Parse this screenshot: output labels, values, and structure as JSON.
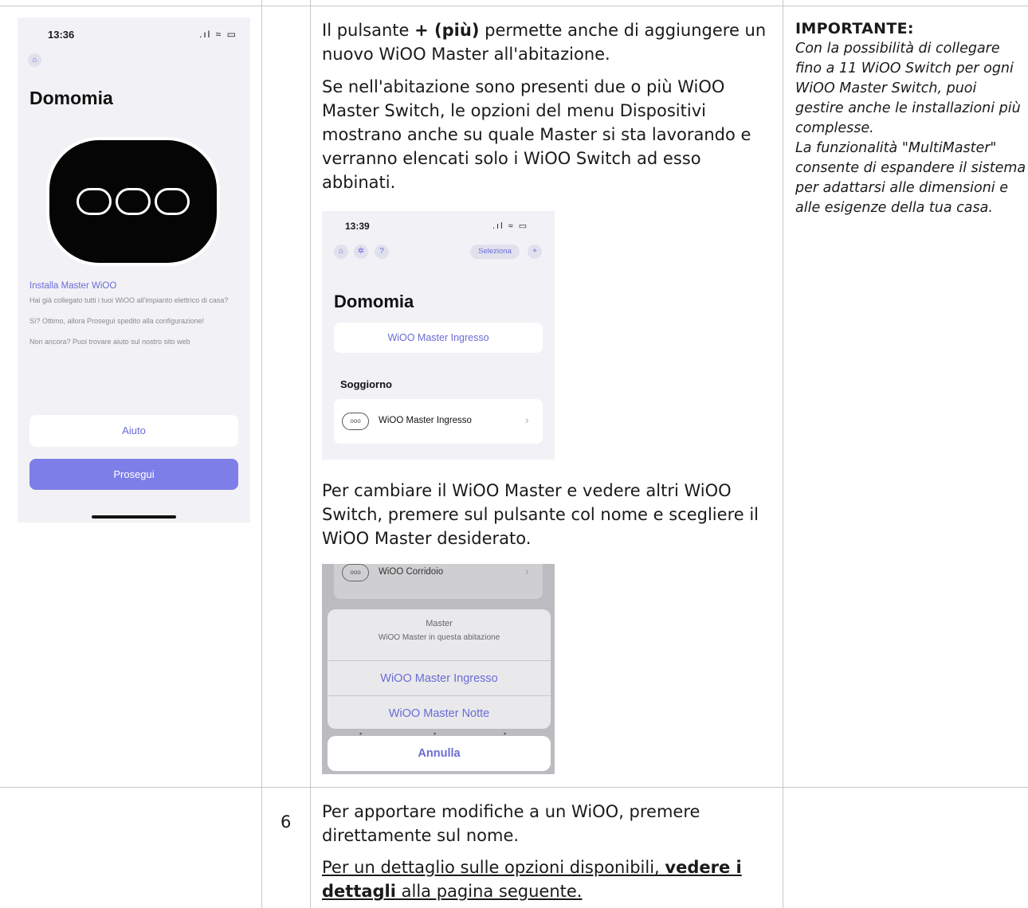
{
  "phone1": {
    "time": "13:36",
    "status": ".ıl ≈ ▭",
    "home_icon": "⌂",
    "title": "Domomia",
    "install_link": "Installa Master WiOO",
    "text1": "Hai già collegato tutti i tuoi WiOO all'impianto elettrico di casa?",
    "text2": "Sì? Ottimo, allora Prosegui spedito alla configurazione!",
    "text3": "Non ancora? Puoi trovare aiuto sul nostro sito web",
    "help_button": "Aiuto",
    "next_button": "Prosegui"
  },
  "phone2": {
    "time": "13:39",
    "status": ".ıl ≈ ▭",
    "home_icon": "⌂",
    "light_icon": "✲",
    "help_icon": "?",
    "select_button": "Seleziona",
    "add_icon": "+",
    "title": "Domomia",
    "master_button": "WiOO Master Ingresso",
    "room": "Soggiorno",
    "device_icon": "ooo",
    "device_label": "WiOO Master Ingresso",
    "chevron": "›"
  },
  "phone3": {
    "device_icon": "ooo",
    "device_label": "WiOO Corridoio",
    "chevron": "›",
    "sheet_title": "Master",
    "sheet_subtitle": "WiOO Master in questa abitazione",
    "option1": "WiOO Master Ingresso",
    "option2": "WiOO Master Notte",
    "cancel": "Annulla"
  },
  "doc": {
    "p1_a": "Il pulsante ",
    "p1_bold": "+ (più)",
    "p1_b": " permette anche di aggiungere un nuovo WiOO Master all'abitazione.",
    "p2": "Se nell'abitazione sono presenti due o più WiOO Master Switch,  le opzioni del menu Dispositivi mostrano anche su quale Master si sta lavorando e verranno elencati solo i WiOO Switch ad esso abbinati.",
    "p3": "Per cambiare il WiOO Master e vedere altri WiOO Switch, premere sul pulsante col nome e scegliere il WiOO Master desiderato.",
    "step_number": "6",
    "p4": "Per apportare modifiche a un WiOO, premere direttamente sul nome.",
    "p5_a": "Per un dettaglio sulle opzioni disponibili, ",
    "p5_bold": "vedere i dettagli",
    "p5_b": " alla pagina seguente."
  },
  "side": {
    "title": "IMPORTANTE:",
    "body1": "Con la possibilità di collegare fino a 11 WiOO Switch per ogni WiOO Master Switch, puoi gestire anche le installazioni più complesse.",
    "body2": "La funzionalità \"MultiMaster\" consente di espandere il sistema per adattarsi alle dimensioni e alle esigenze della tua casa."
  }
}
